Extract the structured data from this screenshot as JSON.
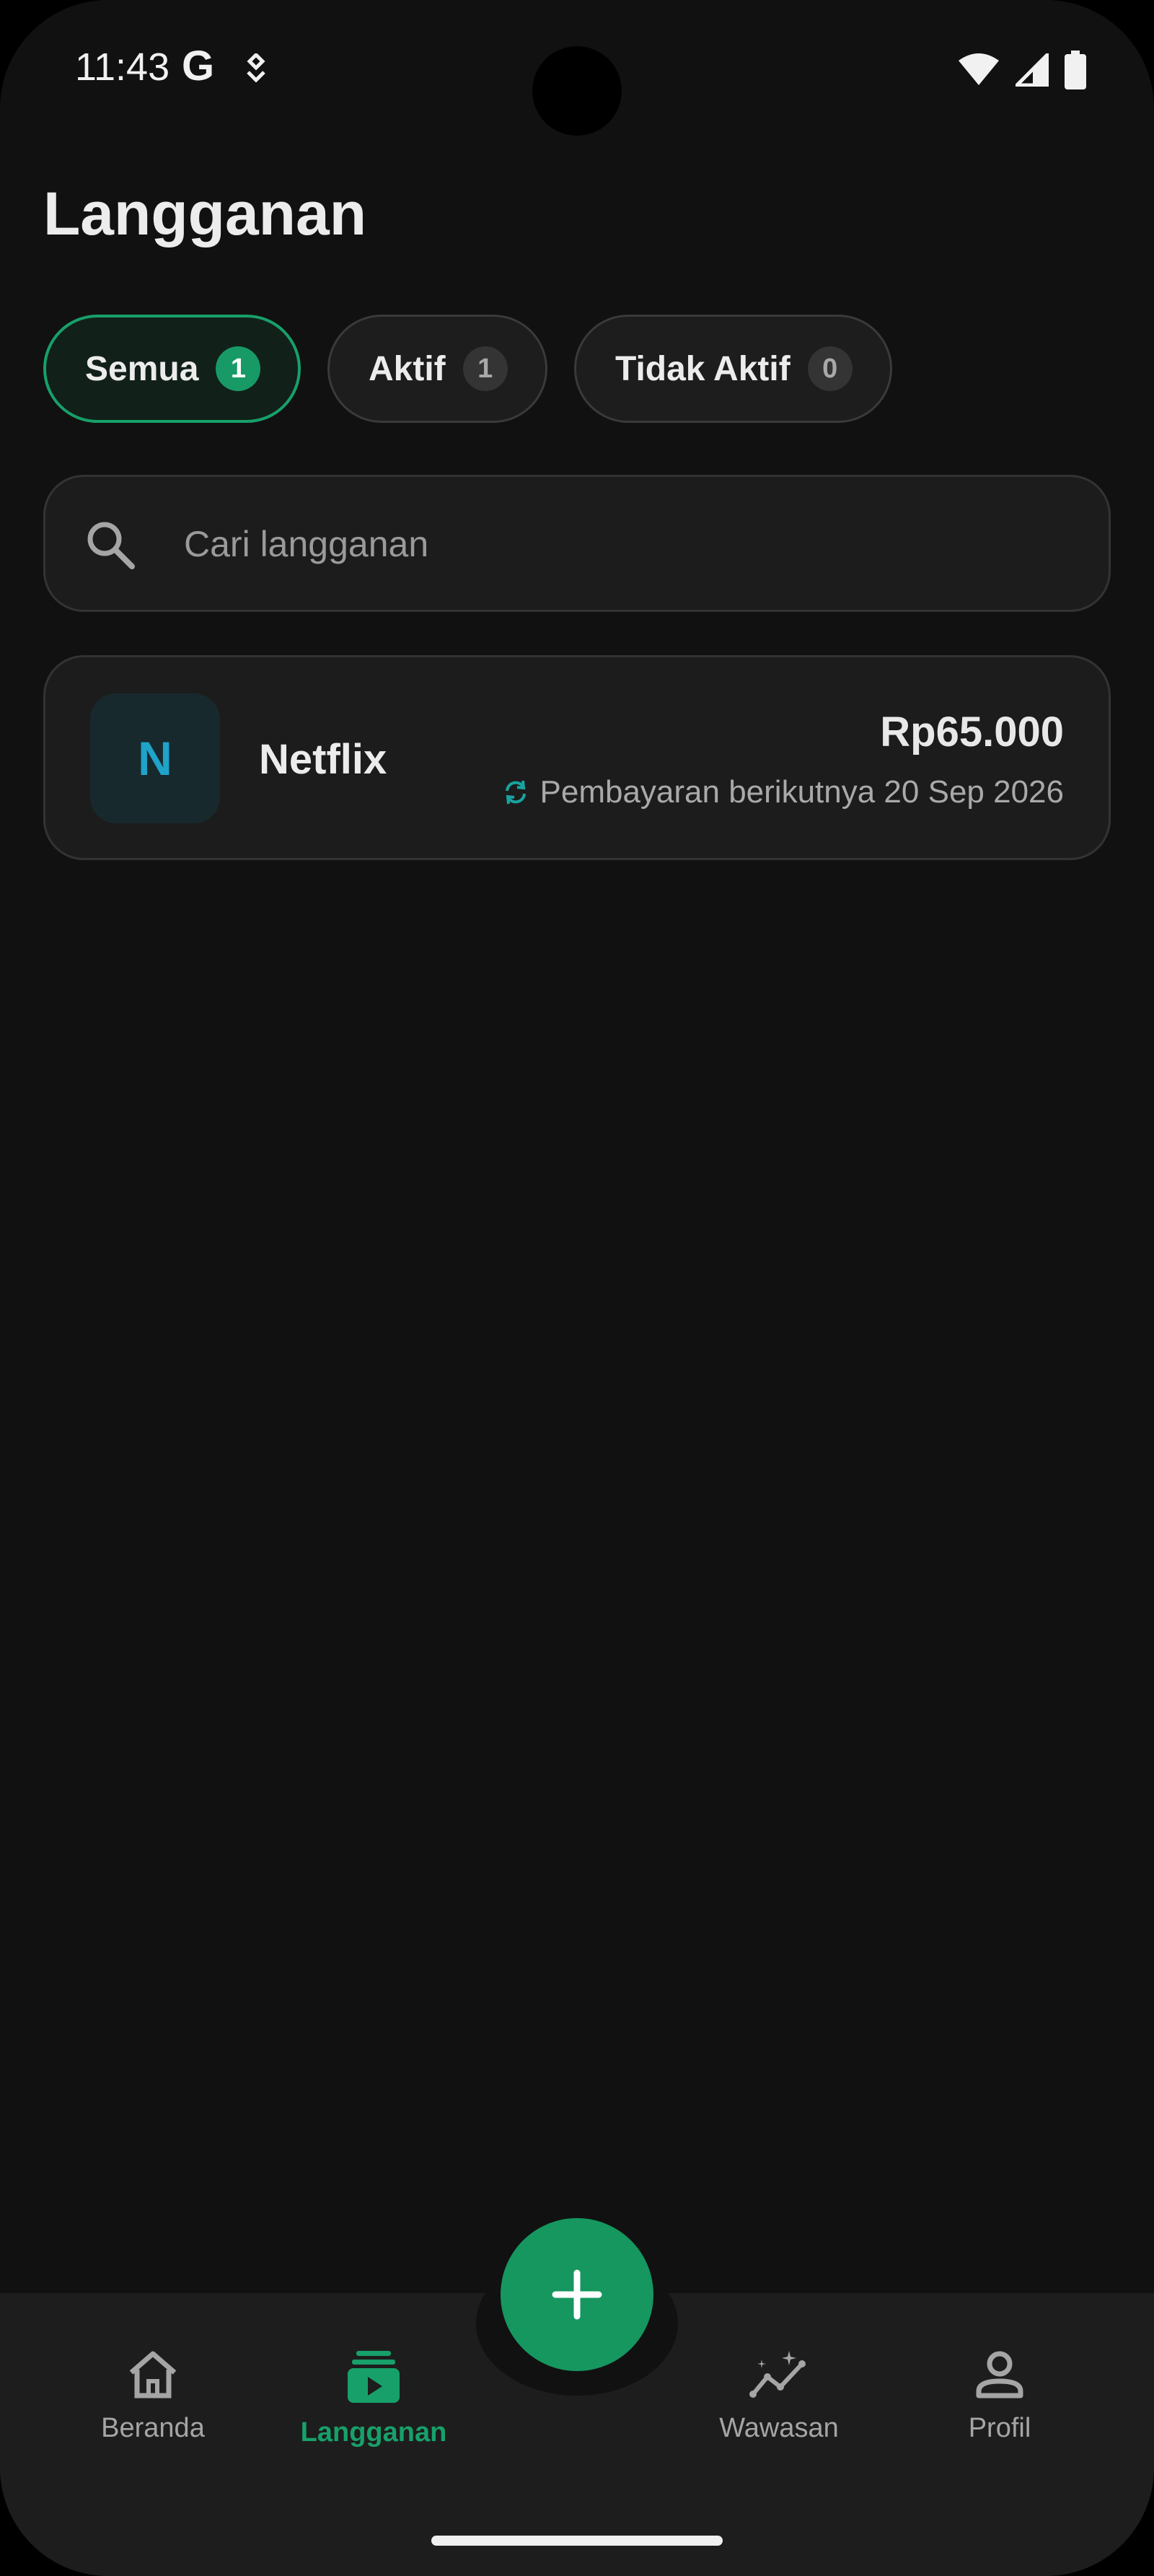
{
  "status_bar": {
    "time": "11:43",
    "google_glyph": "G",
    "icons": [
      "google-icon",
      "location-icon",
      "wifi-icon",
      "signal-icon",
      "battery-icon"
    ]
  },
  "header": {
    "title": "Langganan"
  },
  "filters": [
    {
      "label": "Semua",
      "count": "1",
      "selected": true
    },
    {
      "label": "Aktif",
      "count": "1",
      "selected": false
    },
    {
      "label": "Tidak Aktif",
      "count": "0",
      "selected": false
    }
  ],
  "search": {
    "placeholder": "Cari langganan",
    "value": ""
  },
  "subscriptions": [
    {
      "initial": "N",
      "name": "Netflix",
      "price": "Rp65.000",
      "next_payment": "Pembayaran berikutnya 20 Sep 2026"
    }
  ],
  "fab": {
    "icon": "plus-icon"
  },
  "bottom_nav": [
    {
      "label": "Beranda",
      "icon": "home-icon",
      "active": false
    },
    {
      "label": "Langganan",
      "icon": "subscriptions-icon",
      "active": true
    },
    {
      "label": "Wawasan",
      "icon": "insights-icon",
      "active": false
    },
    {
      "label": "Profil",
      "icon": "profile-icon",
      "active": false
    }
  ],
  "colors": {
    "accent": "#17a06a",
    "background": "#111111",
    "surface": "#1c1c1c",
    "avatar_text": "#1fa3c9"
  }
}
